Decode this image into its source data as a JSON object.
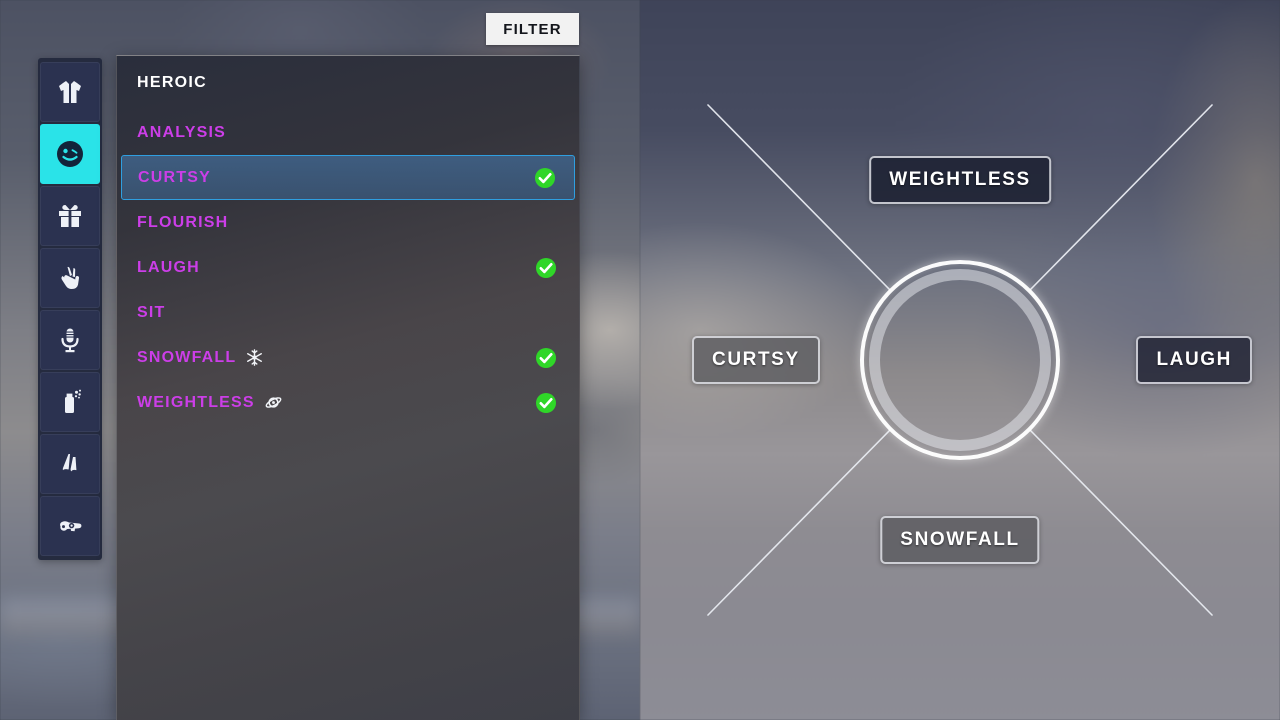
{
  "toolbar": {
    "filter_label": "FILTER"
  },
  "sidebar": {
    "items": [
      {
        "name": "outfit",
        "icon": "shirt-icon",
        "selected": false
      },
      {
        "name": "emote",
        "icon": "emoji-icon",
        "selected": true
      },
      {
        "name": "gift",
        "icon": "gift-icon",
        "selected": false
      },
      {
        "name": "gesture",
        "icon": "peace-hand-icon",
        "selected": false
      },
      {
        "name": "voice",
        "icon": "microphone-icon",
        "selected": false
      },
      {
        "name": "spray",
        "icon": "spray-can-icon",
        "selected": false
      },
      {
        "name": "contrail",
        "icon": "contrail-icon",
        "selected": false
      },
      {
        "name": "wrap",
        "icon": "weapon-wrap-icon",
        "selected": false
      }
    ]
  },
  "list": {
    "header": "HEROIC",
    "items": [
      {
        "label": "ANALYSIS",
        "equipped": false,
        "selected": false,
        "tag": null
      },
      {
        "label": "CURTSY",
        "equipped": true,
        "selected": true,
        "tag": null
      },
      {
        "label": "FLOURISH",
        "equipped": false,
        "selected": false,
        "tag": null
      },
      {
        "label": "LAUGH",
        "equipped": true,
        "selected": false,
        "tag": null
      },
      {
        "label": "SIT",
        "equipped": false,
        "selected": false,
        "tag": null
      },
      {
        "label": "SNOWFALL",
        "equipped": true,
        "selected": false,
        "tag": "snowflake-icon"
      },
      {
        "label": "WEIGHTLESS",
        "equipped": true,
        "selected": false,
        "tag": "planet-orbit-icon"
      }
    ]
  },
  "wheel": {
    "slots": {
      "top": "WEIGHTLESS",
      "right": "LAUGH",
      "bottom": "SNOWFALL",
      "left": "CURTSY"
    }
  },
  "colors": {
    "accent_magenta": "#cc3ee8",
    "accent_cyan": "#2ae3e8",
    "equipped_green": "#2fd628",
    "selection_blue": "#2f9fe0",
    "panel_dark": "#3e3f47"
  }
}
